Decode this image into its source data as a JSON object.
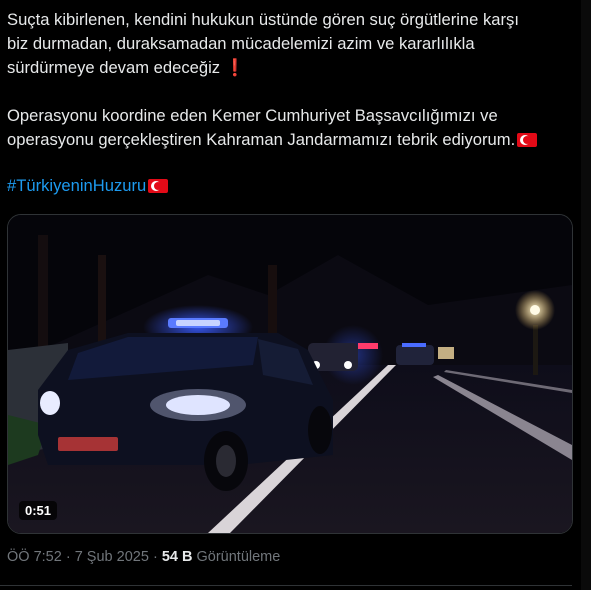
{
  "post": {
    "line1": "Suçta kibirlenen, kendini hukukun üstünde gören suç örgütlerine karşı",
    "line2": "biz durmadan, duraksamadan mücadelemizi azim ve kararlılıkla",
    "line3": "sürdürmeye devam edeceğiz",
    "exclamation": "❗",
    "line4": "Operasyonu koordine eden Kemer Cumhuriyet Başsavcılığımızı ve",
    "line5": "operasyonu gerçekleştiren Kahraman Jandarmamızı tebrik ediyorum.",
    "hashtag": "#TürkiyeninHuzuru"
  },
  "video": {
    "duration": "0:51"
  },
  "meta": {
    "time": "ÖÖ 7:52",
    "separator": "·",
    "date": "7 Şub 2025",
    "views_count": "54 B",
    "views_label": "Görüntüleme"
  },
  "icons": {
    "flag": "turkey-flag-icon",
    "exclamation": "red-exclamation-icon"
  },
  "colors": {
    "background": "#000000",
    "text": "#e7e9ea",
    "link": "#1d9bf0",
    "muted": "#71767b"
  }
}
